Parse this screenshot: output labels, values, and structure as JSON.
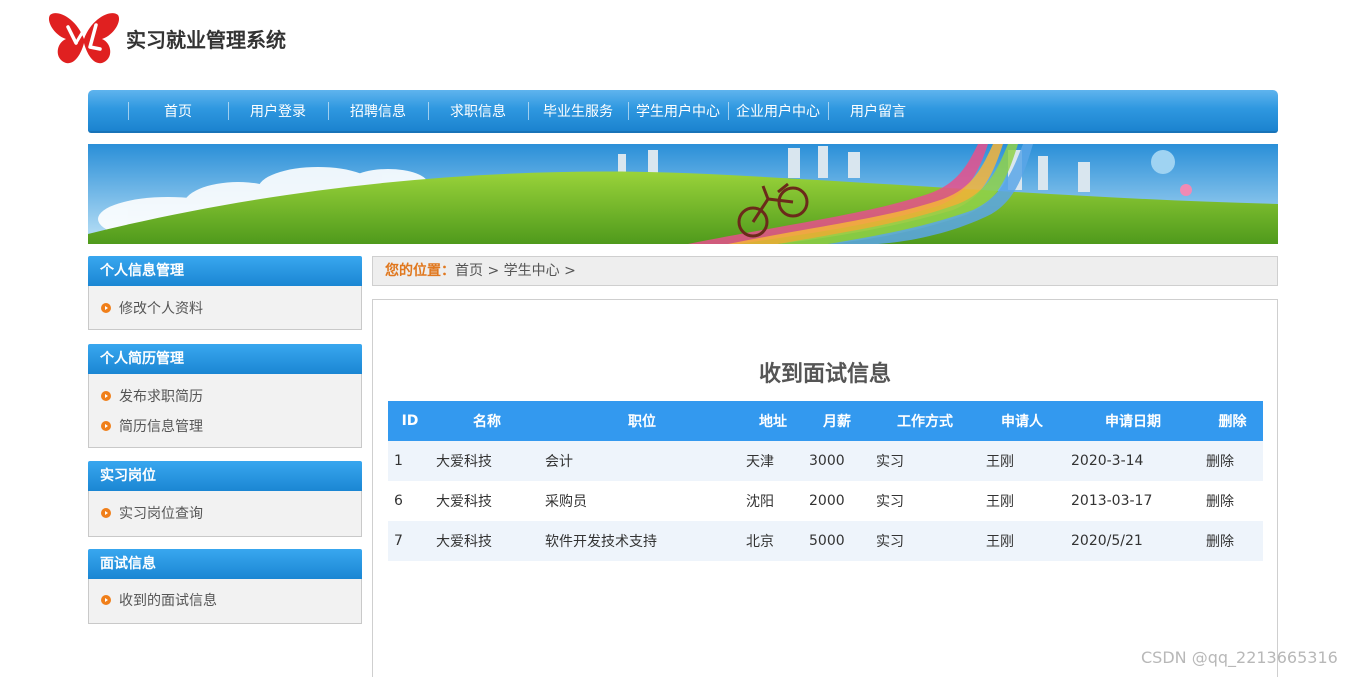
{
  "header": {
    "title": "实习就业管理系统",
    "logo_icon": "butterfly-logo-icon"
  },
  "nav": {
    "items": [
      "首页",
      "用户登录",
      "招聘信息",
      "求职信息",
      "毕业生服务",
      "学生用户中心",
      "企业用户中心",
      "用户留言"
    ]
  },
  "sidebar": {
    "sections": [
      {
        "title": "个人信息管理",
        "items": [
          "修改个人资料"
        ]
      },
      {
        "title": "个人简历管理",
        "items": [
          "发布求职简历",
          "简历信息管理"
        ]
      },
      {
        "title": "实习岗位",
        "items": [
          "实习岗位查询"
        ]
      },
      {
        "title": "面试信息",
        "items": [
          "收到的面试信息"
        ]
      }
    ]
  },
  "breadcrumb": {
    "label": "您的位置：",
    "path": "首页 > 学生中心 >"
  },
  "main": {
    "title": "收到面试信息",
    "columns": [
      "ID",
      "名称",
      "职位",
      "地址",
      "月薪",
      "工作方式",
      "申请人",
      "申请日期",
      "删除"
    ],
    "rows": [
      [
        "1",
        "大爱科技",
        "会计",
        "天津",
        "3000",
        "实习",
        "王刚",
        "2020-3-14",
        "删除"
      ],
      [
        "6",
        "大爱科技",
        "采购员",
        "沈阳",
        "2000",
        "实习",
        "王刚",
        "2013-03-17",
        "删除"
      ],
      [
        "7",
        "大爱科技",
        "软件开发技术支持",
        "北京",
        "5000",
        "实习",
        "王刚",
        "2020/5/21",
        "删除"
      ]
    ]
  },
  "watermark": "CSDN @qq_2213665316",
  "colors": {
    "nav_blue": "#1b83cf",
    "accent_orange": "#e0781f",
    "table_head": "#3399ef"
  }
}
